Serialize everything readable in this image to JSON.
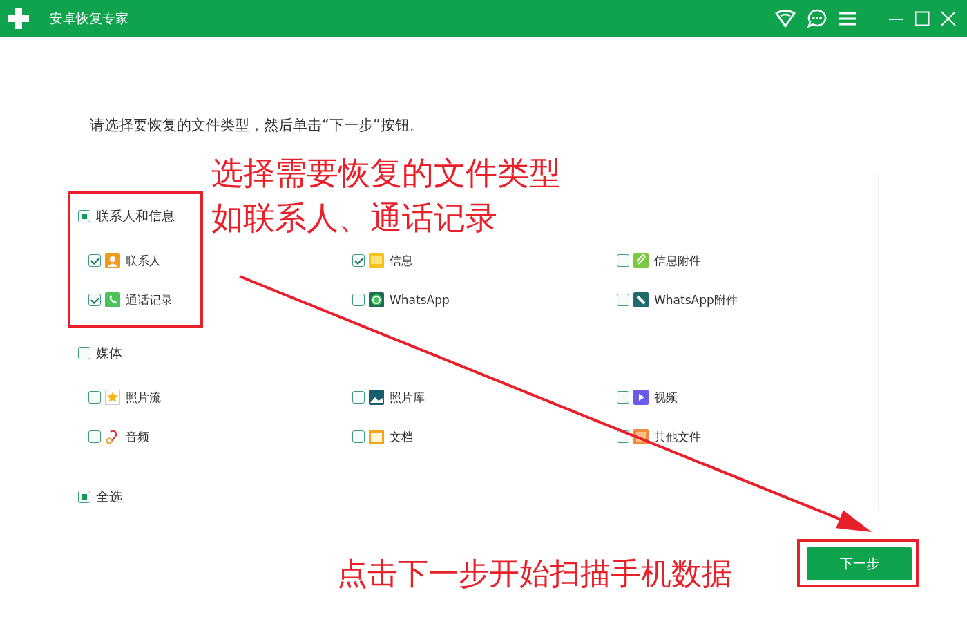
{
  "window": {
    "title": "安卓恢复专家"
  },
  "instruction": "请选择要恢复的文件类型，然后单击“下一步”按钮。",
  "groups": [
    {
      "label": "联系人和信息",
      "partial": true,
      "items": [
        {
          "label": "联系人",
          "checked": true
        },
        {
          "label": "信息",
          "checked": true
        },
        {
          "label": "信息附件",
          "checked": false
        },
        {
          "label": "通话记录",
          "checked": true
        },
        {
          "label": "WhatsApp",
          "checked": false
        },
        {
          "label": "WhatsApp附件",
          "checked": false
        }
      ]
    },
    {
      "label": "媒体",
      "partial": false,
      "items": [
        {
          "label": "照片流",
          "checked": false
        },
        {
          "label": "照片库",
          "checked": false
        },
        {
          "label": "视频",
          "checked": false
        },
        {
          "label": "音频",
          "checked": false
        },
        {
          "label": "文档",
          "checked": false
        },
        {
          "label": "其他文件",
          "checked": false
        }
      ]
    }
  ],
  "select_all": {
    "label": "全选",
    "partial": true
  },
  "next_button": "下一步",
  "annotations": [
    "选择需要恢复的文件类型",
    "如联系人、通话记录",
    "点击下一步开始扫描手机数据"
  ]
}
